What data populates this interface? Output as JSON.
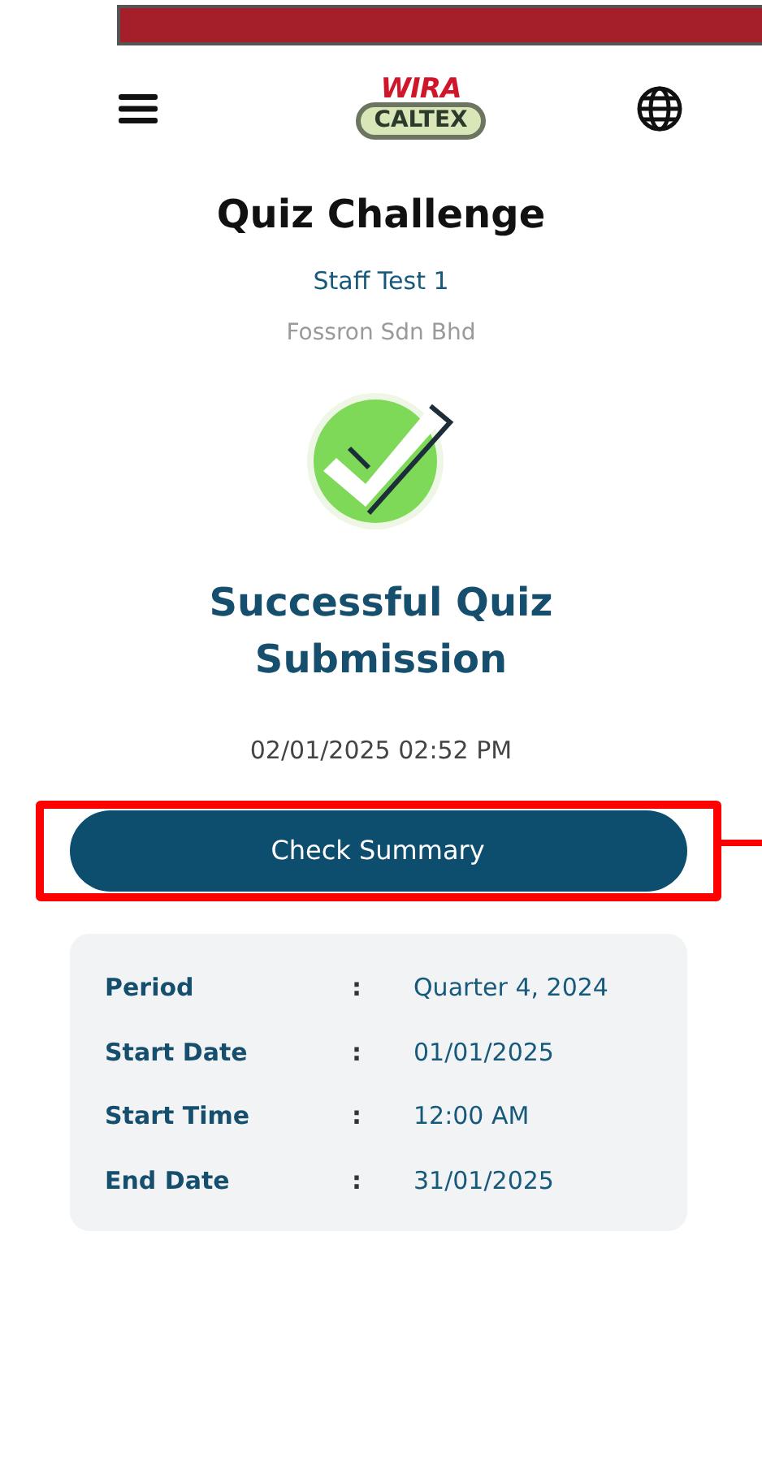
{
  "logo": {
    "line_1": "WIRA",
    "line_2": "CALTEX"
  },
  "title": "Quiz Challenge",
  "quiz_name": "Staff Test 1",
  "company": "Fossron Sdn Bhd",
  "result": {
    "kind": "success",
    "message": "Successful Quiz Submission",
    "timestamp": "02/01/2025 02:52 PM"
  },
  "button": {
    "label": "Check Summary",
    "highlighted": true
  },
  "details": [
    {
      "label": "Period",
      "separator": ":",
      "value": "Quarter 4, 2024"
    },
    {
      "label": "Start Date",
      "separator": ":",
      "value": "01/01/2025"
    },
    {
      "label": "Start Time",
      "separator": ":",
      "value": "12:00 AM"
    },
    {
      "label": "End Date",
      "separator": ":",
      "value": "31/01/2025"
    }
  ]
}
